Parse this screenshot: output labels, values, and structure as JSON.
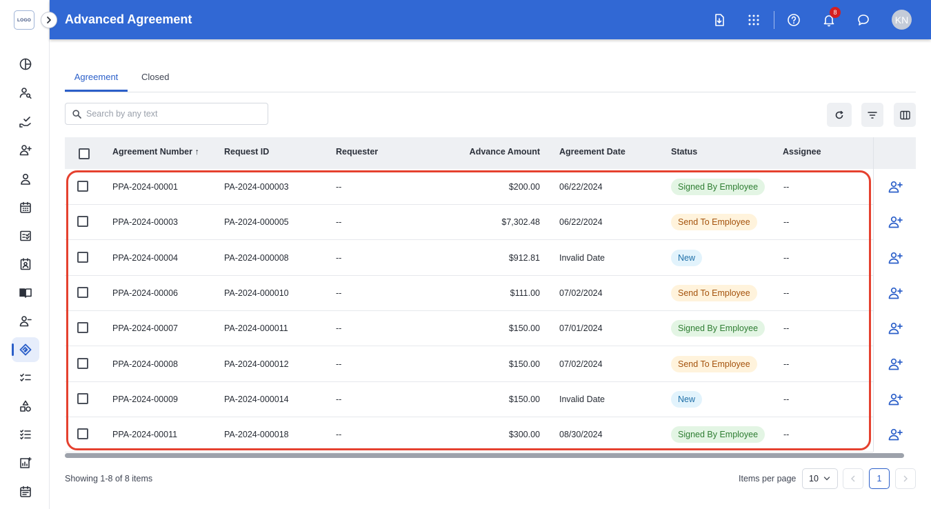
{
  "app": {
    "logo_text": "LOGO",
    "title": "Advanced Agreement",
    "notification_count": "8",
    "user_initials": "KN"
  },
  "colors": {
    "primary": "#3168d4",
    "accent": "#2b5fc9",
    "highlight_border": "#e5412f",
    "status_signed_bg": "#e3f5e4",
    "status_signed_fg": "#2e7d32",
    "status_send_bg": "#fff3dc",
    "status_send_fg": "#a4520c",
    "status_new_bg": "#e2f3fc",
    "status_new_fg": "#1e6fa8"
  },
  "sidebar": {
    "items": [
      {
        "icon": "pie-chart-icon"
      },
      {
        "icon": "user-search-icon"
      },
      {
        "icon": "hand-check-icon"
      },
      {
        "icon": "user-add-icon"
      },
      {
        "icon": "user-icon"
      },
      {
        "icon": "calendar-icon"
      },
      {
        "icon": "checklist-icon"
      },
      {
        "icon": "contact-card-icon"
      },
      {
        "icon": "book-icon"
      },
      {
        "icon": "user-minus-icon"
      },
      {
        "icon": "handshake-icon",
        "active": true
      },
      {
        "icon": "task-list-icon"
      },
      {
        "icon": "shapes-icon"
      },
      {
        "icon": "list-check-icon"
      },
      {
        "icon": "report-chart-icon"
      },
      {
        "icon": "event-calendar-icon"
      }
    ]
  },
  "tabs": [
    {
      "label": "Agreement",
      "active": true
    },
    {
      "label": "Closed",
      "active": false
    }
  ],
  "search": {
    "placeholder": "Search by any text",
    "value": ""
  },
  "table": {
    "columns": [
      "Agreement Number",
      "Request ID",
      "Requester",
      "Advance Amount",
      "Agreement Date",
      "Status",
      "Assignee"
    ],
    "sort_indicator": "↑",
    "rows": [
      {
        "agreement": "PPA-2024-00001",
        "request": "PA-2024-000003",
        "requester": "--",
        "amount": "$200.00",
        "date": "06/22/2024",
        "status": "Signed By Employee",
        "status_type": "signed",
        "assignee": "--"
      },
      {
        "agreement": "PPA-2024-00003",
        "request": "PA-2024-000005",
        "requester": "--",
        "amount": "$7,302.48",
        "date": "06/22/2024",
        "status": "Send To Employee",
        "status_type": "send",
        "assignee": "--"
      },
      {
        "agreement": "PPA-2024-00004",
        "request": "PA-2024-000008",
        "requester": "--",
        "amount": "$912.81",
        "date": "Invalid Date",
        "status": "New",
        "status_type": "new",
        "assignee": "--"
      },
      {
        "agreement": "PPA-2024-00006",
        "request": "PA-2024-000010",
        "requester": "--",
        "amount": "$111.00",
        "date": "07/02/2024",
        "status": "Send To Employee",
        "status_type": "send",
        "assignee": "--"
      },
      {
        "agreement": "PPA-2024-00007",
        "request": "PA-2024-000011",
        "requester": "--",
        "amount": "$150.00",
        "date": "07/01/2024",
        "status": "Signed By Employee",
        "status_type": "signed",
        "assignee": "--"
      },
      {
        "agreement": "PPA-2024-00008",
        "request": "PA-2024-000012",
        "requester": "--",
        "amount": "$150.00",
        "date": "07/02/2024",
        "status": "Send To Employee",
        "status_type": "send",
        "assignee": "--"
      },
      {
        "agreement": "PPA-2024-00009",
        "request": "PA-2024-000014",
        "requester": "--",
        "amount": "$150.00",
        "date": "Invalid Date",
        "status": "New",
        "status_type": "new",
        "assignee": "--"
      },
      {
        "agreement": "PPA-2024-00011",
        "request": "PA-2024-000018",
        "requester": "--",
        "amount": "$300.00",
        "date": "08/30/2024",
        "status": "Signed By Employee",
        "status_type": "signed",
        "assignee": "--"
      }
    ]
  },
  "footer": {
    "showing": "Showing 1-8 of 8 items",
    "items_per_page_label": "Items per page",
    "items_per_page_value": "10",
    "current_page": "1"
  }
}
